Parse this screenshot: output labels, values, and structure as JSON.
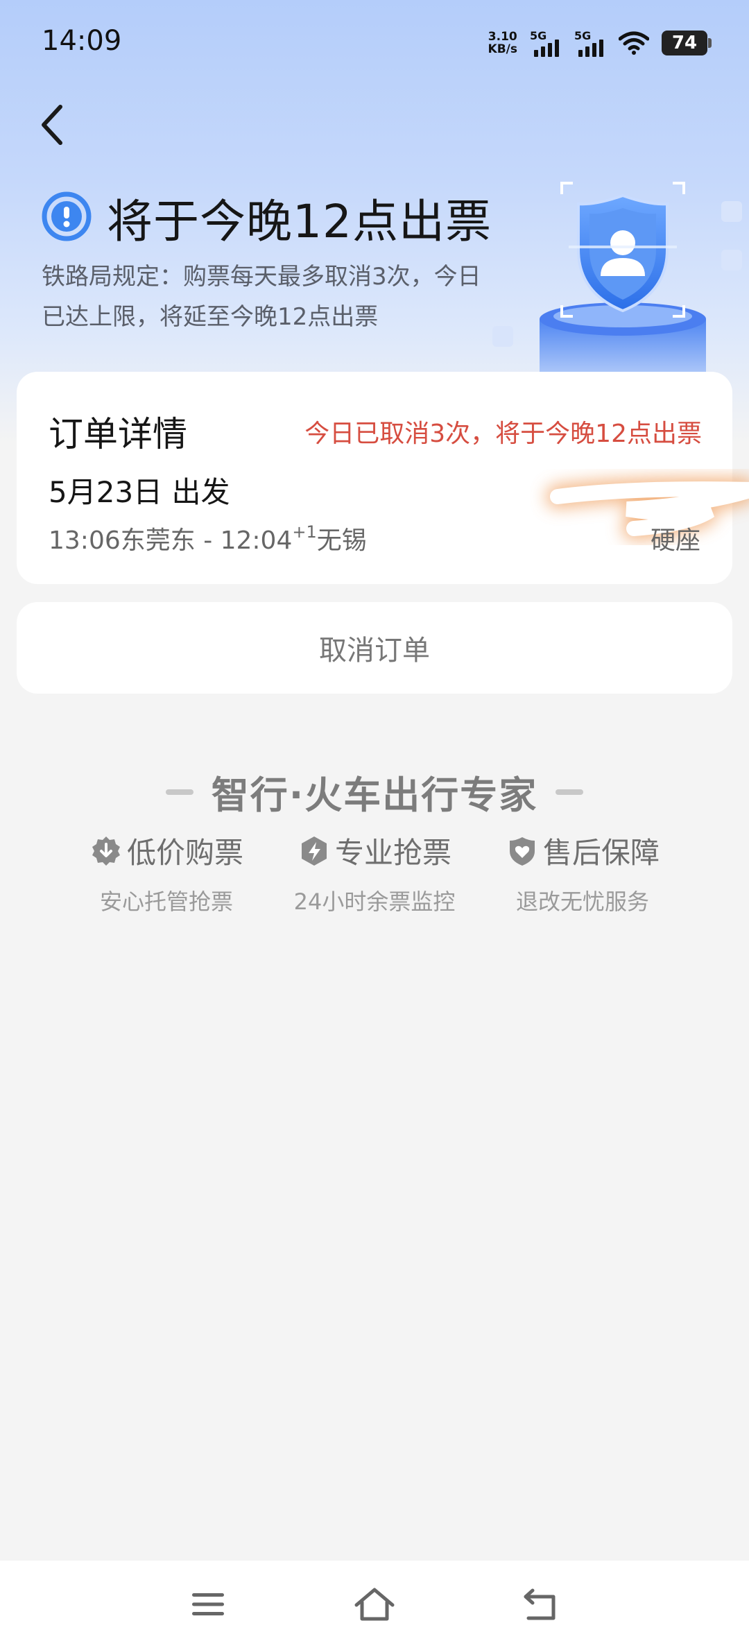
{
  "status_bar": {
    "time": "14:09",
    "net_speed_value": "3.10",
    "net_speed_unit": "KB/s",
    "sim1_label": "5G",
    "sim2_label": "5G",
    "battery": "74"
  },
  "header": {
    "title": "将于今晚12点出票",
    "description": "铁路局规定：购票每天最多取消3次，今日已达上限，将延至今晚12点出票"
  },
  "order_card": {
    "title": "订单详情",
    "warning": "今日已取消3次，将于今晚12点出票",
    "depart_date": "5月23日 出发",
    "route_start": "13:06东莞东 - 12:04",
    "day_offset": "+1",
    "route_end": "无锡",
    "seat_type": "硬座"
  },
  "cancel_button": "取消订单",
  "brand": {
    "title": "智行·火车出行专家"
  },
  "features": [
    {
      "label": "低价购票",
      "sub": "安心托管抢票",
      "icon": "price-badge-icon"
    },
    {
      "label": "专业抢票",
      "sub": "24小时余票监控",
      "icon": "lightning-badge-icon"
    },
    {
      "label": "售后保障",
      "sub": "退改无忧服务",
      "icon": "heart-shield-icon"
    }
  ],
  "colors": {
    "accent_blue": "#3d86f0",
    "warning_red": "#d64d40",
    "hero_gradient_top": "#b4cdfa"
  }
}
